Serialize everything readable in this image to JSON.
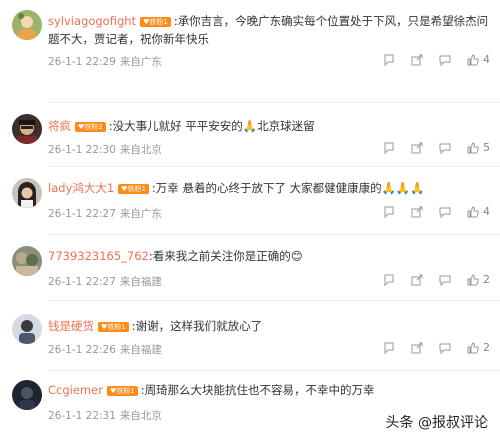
{
  "comments": [
    {
      "username": "sylviagogofight",
      "badge": "铁粉1",
      "text": "承你吉言，今晚广东确实每个位置处于下风，只是希望徐杰问题不大，贾记者，祝你新年快乐",
      "time": "26-1-1 22:29",
      "source": "来自广东",
      "likes": "4"
    },
    {
      "username": "将疯",
      "badge": "铁粉2",
      "text": "没大事儿就好 平平安安的🙏北京球迷留",
      "time": "26-1-1 22:30",
      "source": "来自北京",
      "likes": "5"
    },
    {
      "username": "lady鸿大大1",
      "badge": "铁粉1",
      "text": "万幸 悬着的心终于放下了 大家都健健康康的🙏🙏🙏",
      "time": "26-1-1 22:27",
      "source": "来自广东",
      "likes": "4"
    },
    {
      "username": "7739323165_762",
      "badge": "",
      "text": "看来我之前关注你是正确的😊",
      "time": "26-1-1 22:27",
      "source": "来自福建",
      "likes": "2"
    },
    {
      "username": "钱是硬货",
      "badge": "铁粉1",
      "text": "谢谢，这样我们就放心了",
      "time": "26-1-1 22:26",
      "source": "来自福建",
      "likes": "2"
    },
    {
      "username": "Ccgiemer",
      "badge": "铁粉1",
      "text": "周琦那么大块能抗住也不容易，不幸中的万幸",
      "time": "26-1-1 22:31",
      "source": "来自北京",
      "likes": ""
    }
  ],
  "watermark": "头条 @报叔评论",
  "colors": {
    "username": "#eb7350",
    "badge": "#ff8a16",
    "meta": "#999999"
  }
}
